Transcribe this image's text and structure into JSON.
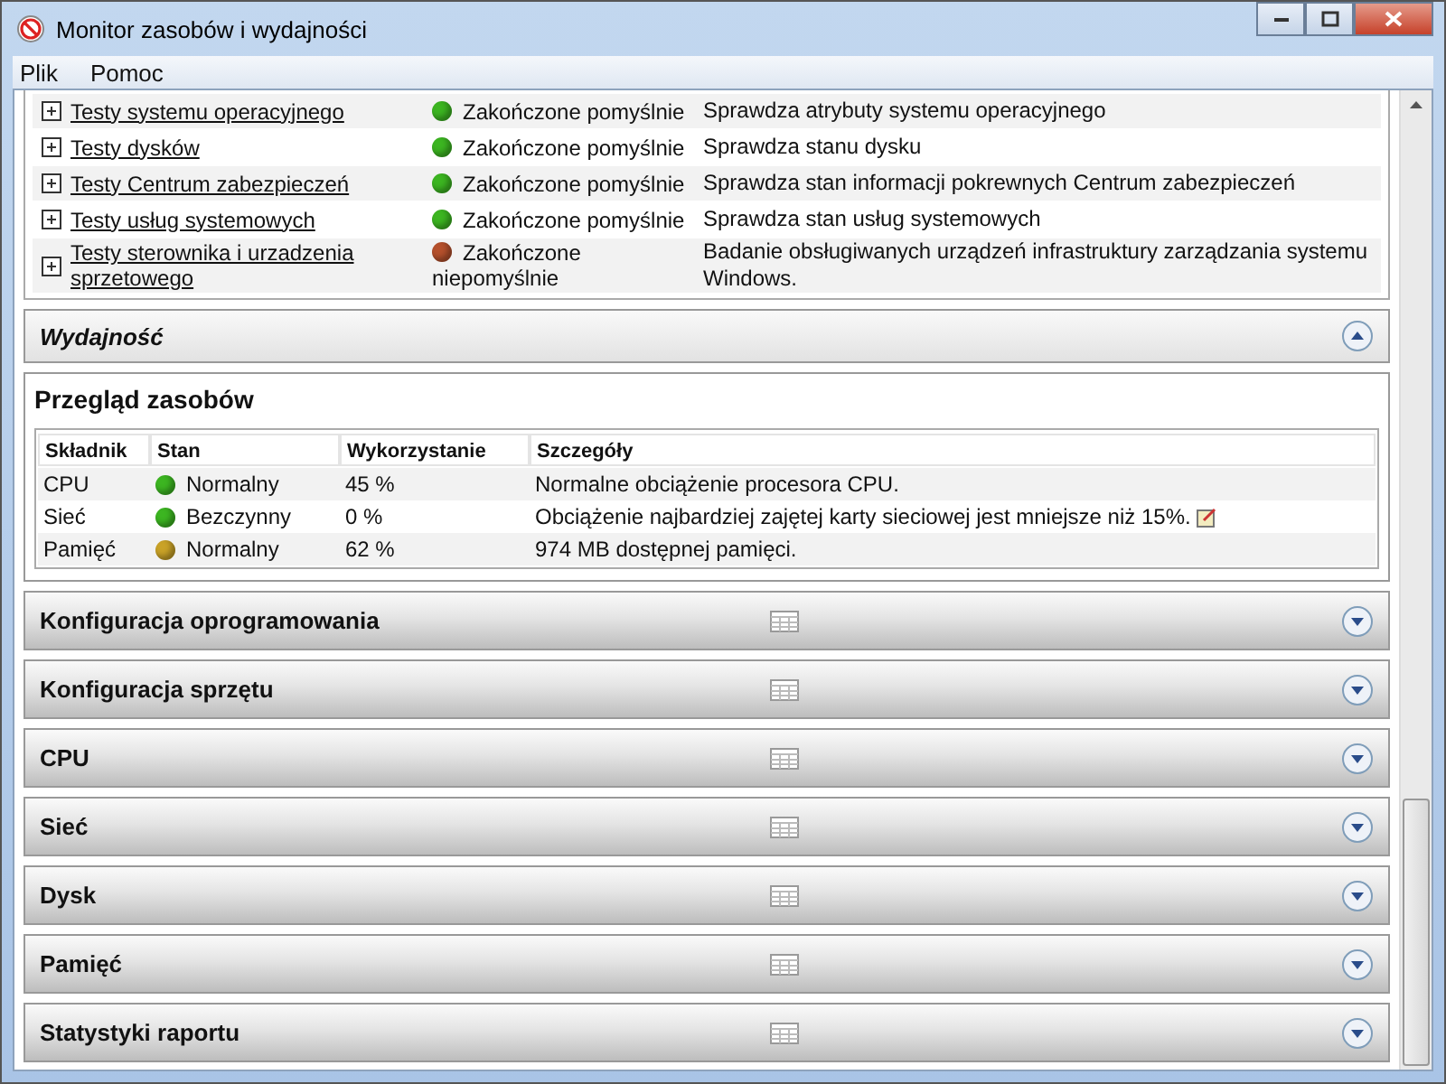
{
  "window": {
    "title": "Monitor zasobów i wydajności"
  },
  "menu": [
    {
      "label": "Plik"
    },
    {
      "label": "Pomoc"
    }
  ],
  "tests": [
    {
      "name": "Testy systemu operacyjnego",
      "status": "Zakończone pomyślnie",
      "color": "#3cb521",
      "description": "Sprawdza atrybuty systemu operacyjnego"
    },
    {
      "name": "Testy dysków",
      "status": "Zakończone pomyślnie",
      "color": "#3cb521",
      "description": "Sprawdza stanu dysku"
    },
    {
      "name": "Testy Centrum zabezpieczeń",
      "status": "Zakończone pomyślnie",
      "color": "#3cb521",
      "description": "Sprawdza stan informacji pokrewnych Centrum zabezpieczeń"
    },
    {
      "name": "Testy usług systemowych",
      "status": "Zakończone pomyślnie",
      "color": "#3cb521",
      "description": "Sprawdza stan usług systemowych"
    },
    {
      "name": "Testy sterownika i urzadzenia sprzetowego",
      "status": "Zakończone niepomyślnie",
      "color": "#b5502c",
      "description": "Badanie obsługiwanych urządzeń infrastruktury zarządzania systemu Windows."
    }
  ],
  "performance": {
    "title": "Wydajność",
    "expanded": true,
    "overview_title": "Przegląd zasobów",
    "columns": [
      "Składnik",
      "Stan",
      "Wykorzystanie",
      "Szczegóły"
    ],
    "rows": [
      {
        "component": "CPU",
        "state": "Normalny",
        "color": "#3cb521",
        "usage": "45 %",
        "details": "Normalne obciążenie procesora CPU.",
        "note": false
      },
      {
        "component": "Sieć",
        "state": "Bezczynny",
        "color": "#3cb521",
        "usage": "0 %",
        "details": "Obciążenie najbardziej zajętej karty sieciowej jest mniejsze niż 15%.",
        "note": true
      },
      {
        "component": "Pamięć",
        "state": "Normalny",
        "color": "#c9a227",
        "usage": "62 %",
        "details": "974 MB dostępnej pamięci.",
        "note": false
      }
    ]
  },
  "sections": [
    {
      "title": "Konfiguracja oprogramowania",
      "expanded": false
    },
    {
      "title": "Konfiguracja sprzętu",
      "expanded": false
    },
    {
      "title": "CPU",
      "expanded": false
    },
    {
      "title": "Sieć",
      "expanded": false
    },
    {
      "title": "Dysk",
      "expanded": false
    },
    {
      "title": "Pamięć",
      "expanded": false
    },
    {
      "title": "Statystyki raportu",
      "expanded": false
    }
  ]
}
